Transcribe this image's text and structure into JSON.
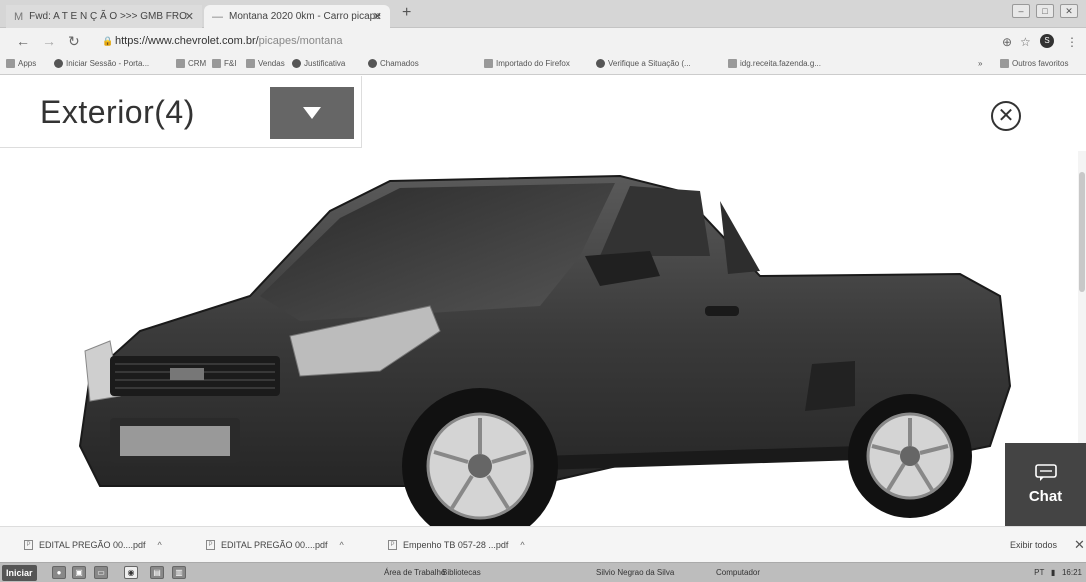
{
  "tabs": [
    {
      "title": "Fwd: A T E N Ç Ã O >>> GMB FRO",
      "favicon": "M",
      "close": "✕"
    },
    {
      "title": "Montana 2020 0km - Carro picape",
      "favicon": "—",
      "close": "✕"
    }
  ],
  "new_tab_label": "+",
  "address_bar": {
    "url_main": "https://www.chevrolet.com.br/",
    "url_path": "picapes/montana"
  },
  "bookmarks": [
    {
      "label": "Apps"
    },
    {
      "label": "Iniciar Sessão - Porta..."
    },
    {
      "label": "CRM"
    },
    {
      "label": "F&I"
    },
    {
      "label": "Vendas"
    },
    {
      "label": "Justificativa"
    },
    {
      "label": "Chamados"
    },
    {
      "label": "Importado do Firefox"
    },
    {
      "label": "Verifique a Situação (..."
    },
    {
      "label": "idg.receita.fazenda.g..."
    },
    {
      "label": "»"
    },
    {
      "label": "Outros favoritos"
    }
  ],
  "gallery": {
    "title": "Exterior(4)",
    "close_symbol": "✕"
  },
  "chat": {
    "label": "Chat"
  },
  "downloads": {
    "items": [
      {
        "name": "EDITAL PREGÃO 00....pdf",
        "chevron": "^"
      },
      {
        "name": "EDITAL PREGÃO 00....pdf",
        "chevron": "^"
      },
      {
        "name": "Empenho TB 057-28 ...pdf",
        "chevron": "^"
      }
    ],
    "show_all": "Exibir todos",
    "close": "✕"
  },
  "taskbar": {
    "start": "Iniciar",
    "items": [
      {
        "label": "Área de Trabalho"
      },
      {
        "label": "Bibliotecas"
      },
      {
        "label": "Silvio Negrao da Silva"
      },
      {
        "label": "Computador"
      }
    ],
    "tray": "PT",
    "clock": "16:21"
  },
  "icons": [
    "back-icon",
    "forward-icon",
    "reload-icon",
    "lock-icon",
    "zoom-icon",
    "star-icon",
    "menu-icon",
    "chevron-down-icon",
    "close-circle-icon",
    "chat-icon",
    "pdf-icon"
  ]
}
